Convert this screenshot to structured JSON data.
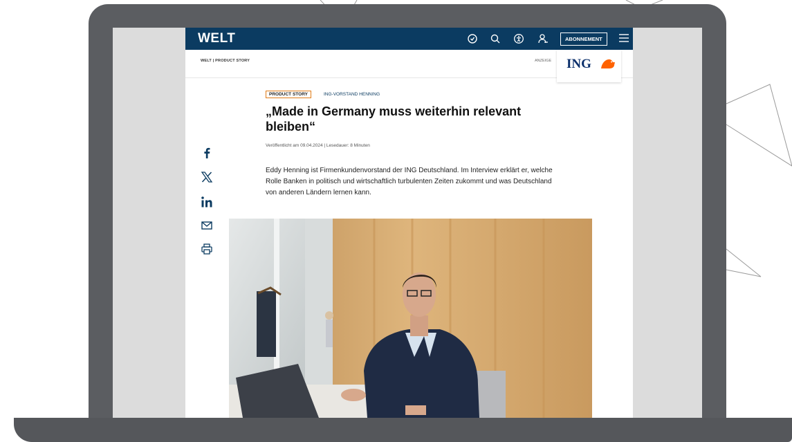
{
  "colors": {
    "laptop": "#5b5d61",
    "welt_navy": "#0b3b61",
    "tag_border": "#e07b16",
    "ing_blue": "#0b2f6b",
    "ing_orange": "#ff6200"
  },
  "header": {
    "logo": "WELT",
    "icons": [
      "clock-icon",
      "search-icon",
      "accessibility-icon",
      "user-icon",
      "menu-icon"
    ],
    "subscribe_label": "ABONNEMENT"
  },
  "subheader": {
    "section_label": "WELT | PRODUCT STORY",
    "ad_label": "ANZEIGE",
    "sponsor_logo": "ING"
  },
  "article": {
    "tag": "PRODUCT STORY",
    "kicker": "ING-VORSTAND HENNING",
    "headline": "„Made in Germany muss weiterhin relevant bleiben“",
    "meta": "Veröffentlicht am 09.04.2024 | Lesedauer: 8 Minuten",
    "intro": "Eddy Henning ist Firmenkundenvorstand der ING Deutschland. Im Interview erklärt er, welche Rolle Banken in politisch und wirtschaftlich turbulenten Zeiten zukommt und was Deutschland von anderen Ländern lernen kann."
  },
  "share": [
    "facebook-icon",
    "x-icon",
    "linkedin-icon",
    "email-icon",
    "print-icon"
  ]
}
